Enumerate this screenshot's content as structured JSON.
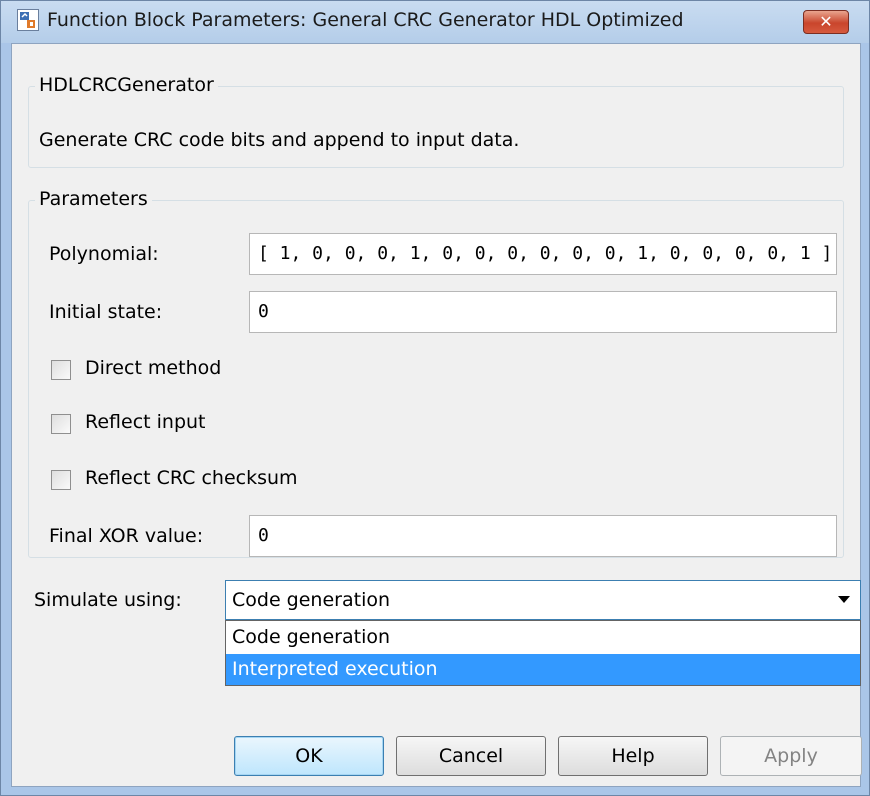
{
  "window": {
    "title": "Function Block Parameters: General CRC Generator HDL Optimized",
    "close_label": "✕"
  },
  "description_group": {
    "legend": "HDLCRCGenerator",
    "text": "Generate CRC code bits and append to input data."
  },
  "parameters_group": {
    "legend": "Parameters",
    "polynomial": {
      "label": "Polynomial:",
      "value": "[ 1, 0, 0, 0, 1, 0, 0, 0, 0, 0, 0, 1, 0, 0, 0, 0, 1 ]"
    },
    "initial_state": {
      "label": "Initial state:",
      "value": "0"
    },
    "checkboxes": [
      {
        "label": "Direct method",
        "checked": false
      },
      {
        "label": "Reflect input",
        "checked": false
      },
      {
        "label": "Reflect CRC checksum",
        "checked": false
      }
    ],
    "final_xor": {
      "label": "Final XOR value:",
      "value": "0"
    }
  },
  "simulate": {
    "label": "Simulate using:",
    "selected": "Code generation",
    "options": [
      "Code generation",
      "Interpreted execution"
    ],
    "highlighted_option": "Interpreted execution"
  },
  "buttons": {
    "ok": "OK",
    "cancel": "Cancel",
    "help": "Help",
    "apply": "Apply"
  },
  "colors": {
    "highlight": "#3399ff",
    "close_button": "#c9452c",
    "dialog_background": "#f0f0f0"
  }
}
